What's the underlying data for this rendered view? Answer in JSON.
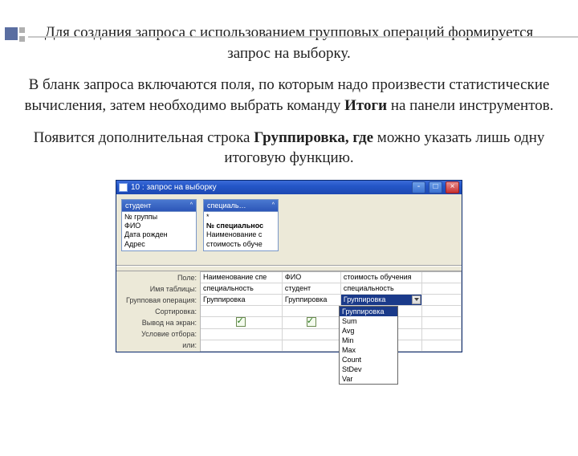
{
  "para1_a": "Для создания запроса с использованием групповых операций формируется запрос на выборку.",
  "para2_a": "В бланк запроса включаются поля, по которым надо произвести статистические вычисления,  затем необходимо выбрать команду ",
  "para2_bold": "Итоги",
  "para2_b": " на панели инструментов.",
  "para3_a": "Появится дополнительная  строка ",
  "para3_bold": "Группировка, где",
  "para3_b": "  можно указать лишь одну итоговую функцию.",
  "window": {
    "title": "10 : запрос на выборку",
    "tables": [
      {
        "name": "студент",
        "fields": [
          "№ группы",
          "ФИО",
          "Дата рожден",
          "Адрес"
        ]
      },
      {
        "name": "специаль…",
        "fields": [
          "*",
          "№ специальнос",
          "Наименование с",
          "стоимость обуче"
        ],
        "bold_index": 1
      }
    ],
    "row_labels": [
      "Поле:",
      "Имя таблицы:",
      "Групповая операция:",
      "Сортировка:",
      "Вывод на экран:",
      "Условие отбора:",
      "или:"
    ],
    "grid": {
      "cols": [
        {
          "field": "Наименование спе",
          "table": "специальность",
          "group": "Группировка",
          "show": true
        },
        {
          "field": "ФИО",
          "table": "студент",
          "group": "Группировка",
          "show": true
        },
        {
          "field": "стоимость обучения",
          "table": "специальность",
          "group": "Группировка",
          "show": true,
          "selected": true
        },
        {
          "field": "",
          "table": "",
          "group": "",
          "show": false
        }
      ]
    },
    "dropdown_options": [
      "Группировка",
      "Sum",
      "Avg",
      "Min",
      "Max",
      "Count",
      "StDev",
      "Var"
    ],
    "dropdown_selected_index": 0
  }
}
